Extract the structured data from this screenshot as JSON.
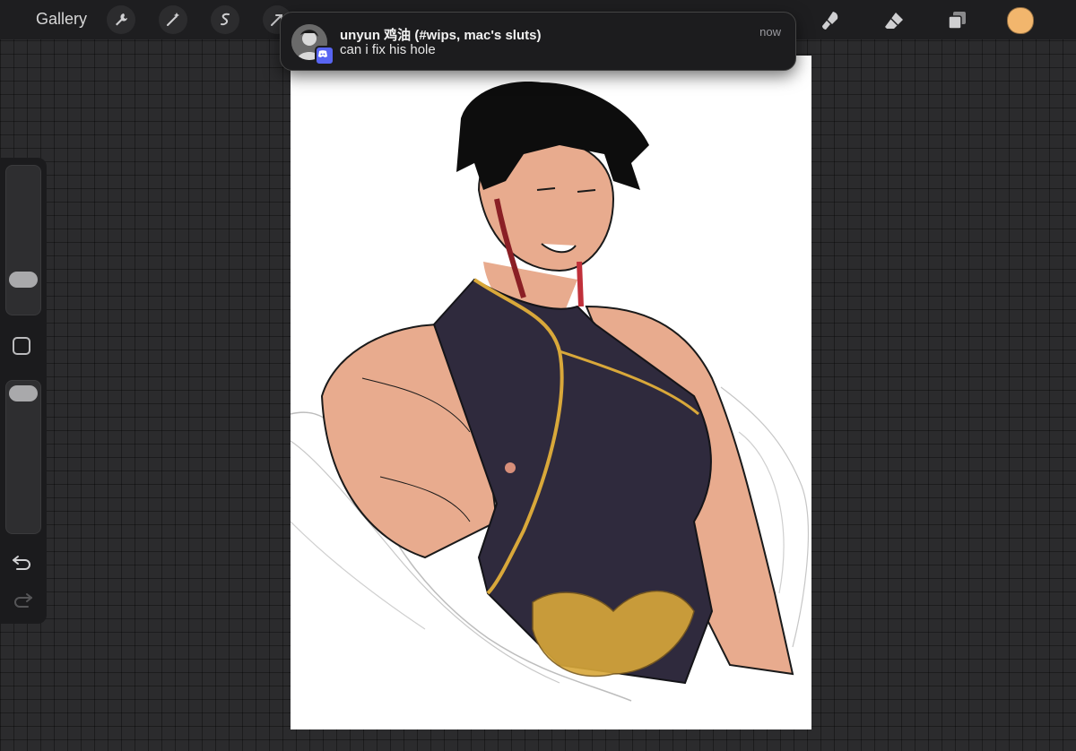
{
  "toolbar": {
    "gallery_label": "Gallery",
    "left_tools": [
      "wrench-icon",
      "magic-wand-icon",
      "selection-icon",
      "transform-icon"
    ],
    "right_tools": [
      "brush-icon",
      "smudge-icon",
      "eraser-icon",
      "layers-icon"
    ],
    "current_color": "#f2b66d"
  },
  "sidebar": {
    "brush_size_level": 0.22,
    "opacity_level": 0.94,
    "icons": [
      "modify-square-icon",
      "undo-icon",
      "redo-icon"
    ]
  },
  "notification": {
    "app": "Discord",
    "title": "unyun 鸡油 (#wips, mac's sluts)",
    "body": "can i fix his hole",
    "time": "now"
  },
  "canvas": {
    "content": "illustration"
  },
  "colors": {
    "background": "#2b2b2d",
    "toolbar": "#1e1e20",
    "notification": "#1c1c1e",
    "discord_brand": "#5865f2",
    "skin": "#e8ab8e",
    "top_fabric": "#2f2a3d",
    "gold_trim": "#d9a83a"
  }
}
